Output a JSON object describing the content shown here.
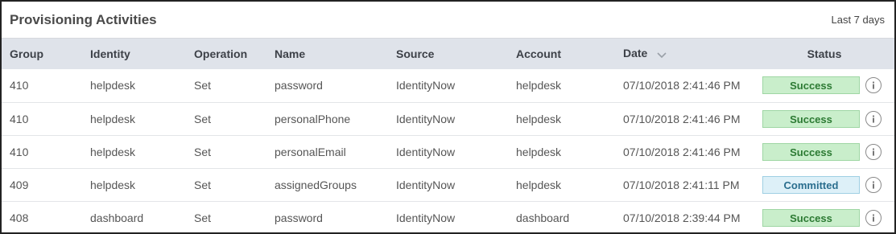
{
  "header": {
    "title": "Provisioning Activities",
    "range": "Last 7 days"
  },
  "columns": [
    "Group",
    "Identity",
    "Operation",
    "Name",
    "Source",
    "Account",
    "Date",
    "Status"
  ],
  "rows": [
    {
      "group": "410",
      "identity": "helpdesk",
      "operation": "Set",
      "name": "password",
      "source": "IdentityNow",
      "account": "helpdesk",
      "date": "07/10/2018 2:41:46 PM",
      "status": "Success"
    },
    {
      "group": "410",
      "identity": "helpdesk",
      "operation": "Set",
      "name": "personalPhone",
      "source": "IdentityNow",
      "account": "helpdesk",
      "date": "07/10/2018 2:41:46 PM",
      "status": "Success"
    },
    {
      "group": "410",
      "identity": "helpdesk",
      "operation": "Set",
      "name": "personalEmail",
      "source": "IdentityNow",
      "account": "helpdesk",
      "date": "07/10/2018 2:41:46 PM",
      "status": "Success"
    },
    {
      "group": "409",
      "identity": "helpdesk",
      "operation": "Set",
      "name": "assignedGroups",
      "source": "IdentityNow",
      "account": "helpdesk",
      "date": "07/10/2018 2:41:11 PM",
      "status": "Committed"
    },
    {
      "group": "408",
      "identity": "dashboard",
      "operation": "Set",
      "name": "password",
      "source": "IdentityNow",
      "account": "dashboard",
      "date": "07/10/2018 2:39:44 PM",
      "status": "Success"
    }
  ],
  "icons": {
    "sort": "chevron-down-icon",
    "info": "info-icon"
  },
  "colors": {
    "success_bg": "#c9eecb",
    "success_text": "#2c7a33",
    "committed_bg": "#ddf0f8",
    "committed_text": "#2a6e8e",
    "header_bg": "#dfe3ea"
  }
}
